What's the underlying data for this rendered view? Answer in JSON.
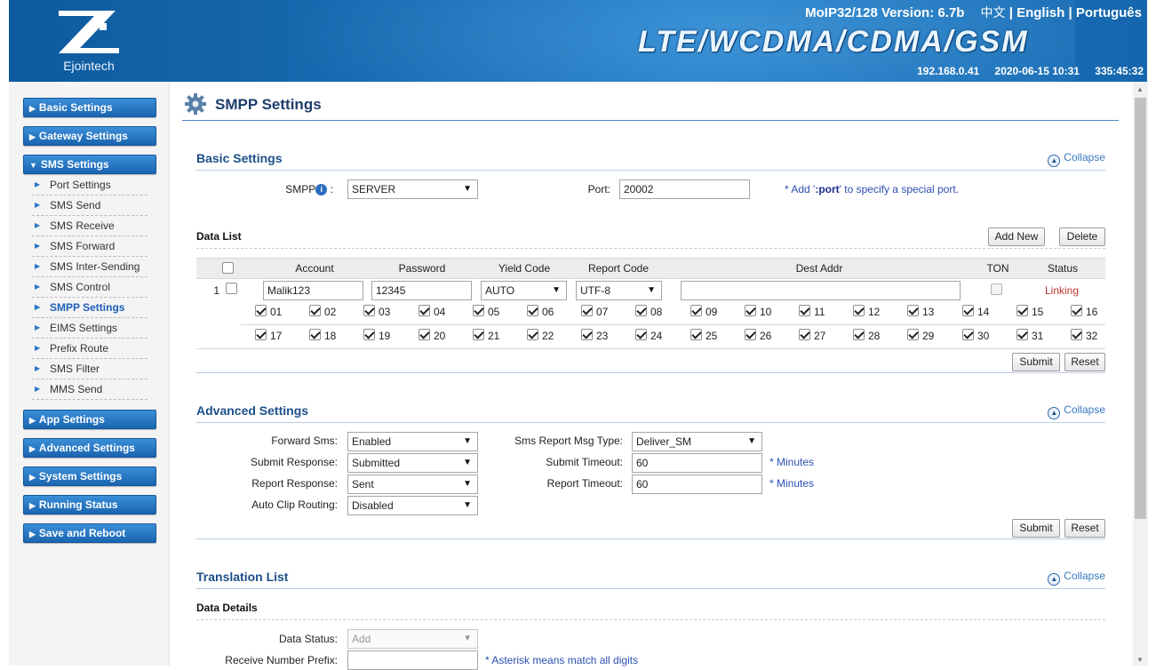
{
  "header": {
    "brand": "Ejointech",
    "version": "MoIP32/128 Version: 6.7b",
    "lang_cn": "中文",
    "lang_sep1": "|",
    "lang_en": "English",
    "lang_sep2": "|",
    "lang_pt": "Português",
    "title": "LTE/WCDMA/CDMA/GSM",
    "ip": "192.168.0.41",
    "datetime": "2020-06-15 10:31",
    "uptime": "335:45:32"
  },
  "sidebar": {
    "basic": "Basic Settings",
    "gateway": "Gateway Settings",
    "sms": "SMS Settings",
    "sms_items": [
      "Port Settings",
      "SMS Send",
      "SMS Receive",
      "SMS Forward",
      "SMS Inter-Sending",
      "SMS Control",
      "SMPP Settings",
      "EIMS Settings",
      "Prefix Route",
      "SMS Filter",
      "MMS Send"
    ],
    "app": "App Settings",
    "advanced": "Advanced Settings",
    "system": "System Settings",
    "running": "Running Status",
    "save": "Save and Reboot"
  },
  "page": {
    "title": "SMPP Settings",
    "collapse": "Collapse"
  },
  "basic": {
    "title": "Basic Settings",
    "smpp_label": "SMPP",
    "smpp_colon": ":",
    "smpp_value": "SERVER",
    "port_label": "Port:",
    "port_value": "20002",
    "hint_pre": "* Add '",
    "hint_bold": ":port",
    "hint_post": "' to specify a special port."
  },
  "datalist": {
    "title": "Data List",
    "add_new": "Add New",
    "delete": "Delete",
    "columns": [
      "Account",
      "Password",
      "Yield Code",
      "Report Code",
      "Dest Addr",
      "TON",
      "Status"
    ],
    "row": {
      "index": "1",
      "account": "Malik123",
      "password": "12345",
      "yield_code": "AUTO",
      "report_code": "UTF-8",
      "dest_addr": "",
      "status": "Linking"
    },
    "ports_row1": [
      "01",
      "02",
      "03",
      "04",
      "05",
      "06",
      "07",
      "08",
      "09",
      "10",
      "11",
      "12",
      "13",
      "14",
      "15",
      "16"
    ],
    "ports_row2": [
      "17",
      "18",
      "19",
      "20",
      "21",
      "22",
      "23",
      "24",
      "25",
      "26",
      "27",
      "28",
      "29",
      "30",
      "31",
      "32"
    ],
    "submit": "Submit",
    "reset": "Reset"
  },
  "advanced": {
    "title": "Advanced Settings",
    "forward_sms_label": "Forward Sms:",
    "forward_sms_value": "Enabled",
    "submit_response_label": "Submit Response:",
    "submit_response_value": "Submitted",
    "report_response_label": "Report Response:",
    "report_response_value": "Sent",
    "auto_clip_label": "Auto Clip Routing:",
    "auto_clip_value": "Disabled",
    "report_msg_type_label": "Sms Report Msg Type:",
    "report_msg_type_value": "Deliver_SM",
    "submit_timeout_label": "Submit Timeout:",
    "submit_timeout_value": "60",
    "report_timeout_label": "Report Timeout:",
    "report_timeout_value": "60",
    "minutes": "* Minutes",
    "submit": "Submit",
    "reset": "Reset"
  },
  "translation": {
    "title": "Translation List",
    "details_title": "Data Details",
    "data_status_label": "Data Status:",
    "data_status_value": "Add",
    "prefix_label": "Receive Number Prefix:",
    "prefix_value": "",
    "prefix_hint": "* Asterisk means match all digits"
  },
  "icons": {
    "gear": "gear-icon",
    "info": "info-icon",
    "collapse": "collapse-up-icon",
    "arrow": "arrow-right-icon",
    "arrow_down": "arrow-down-icon"
  },
  "colors": {
    "header_blue": "#1a6cb3",
    "nav_blue": "#2a7ac8",
    "section_title": "#1d4f8a",
    "active_link": "#1f5fb8",
    "status_red": "#c0392b"
  }
}
